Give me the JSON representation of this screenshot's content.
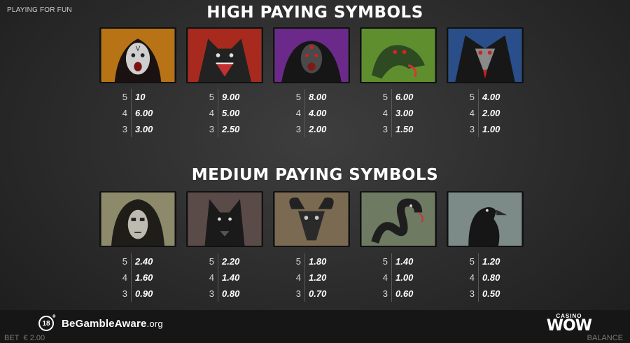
{
  "mode_label": "PLAYING FOR FUN",
  "high": {
    "title": "HIGH PAYING SYMBOLS",
    "symbols": [
      {
        "icon": "witch-face-icon",
        "bg": "#b87316",
        "pays": [
          {
            "count": "5",
            "amount": "10"
          },
          {
            "count": "4",
            "amount": "6.00"
          },
          {
            "count": "3",
            "amount": "3.00"
          }
        ]
      },
      {
        "icon": "werewolf-icon",
        "bg": "#a82a1e",
        "pays": [
          {
            "count": "5",
            "amount": "9.00"
          },
          {
            "count": "4",
            "amount": "5.00"
          },
          {
            "count": "3",
            "amount": "2.50"
          }
        ]
      },
      {
        "icon": "demon-icon",
        "bg": "#6b2a8a",
        "pays": [
          {
            "count": "5",
            "amount": "8.00"
          },
          {
            "count": "4",
            "amount": "4.00"
          },
          {
            "count": "3",
            "amount": "2.00"
          }
        ]
      },
      {
        "icon": "serpent-dragon-icon",
        "bg": "#5e8e2e",
        "pays": [
          {
            "count": "5",
            "amount": "6.00"
          },
          {
            "count": "4",
            "amount": "3.00"
          },
          {
            "count": "3",
            "amount": "1.50"
          }
        ]
      },
      {
        "icon": "raven-skull-icon",
        "bg": "#2a4e8a",
        "pays": [
          {
            "count": "5",
            "amount": "4.00"
          },
          {
            "count": "4",
            "amount": "2.00"
          },
          {
            "count": "3",
            "amount": "1.00"
          }
        ]
      }
    ]
  },
  "medium": {
    "title": "MEDIUM PAYING SYMBOLS",
    "symbols": [
      {
        "icon": "hooded-ghoul-icon",
        "bg": "#8c8a6a",
        "pays": [
          {
            "count": "5",
            "amount": "2.40"
          },
          {
            "count": "4",
            "amount": "1.60"
          },
          {
            "count": "3",
            "amount": "0.90"
          }
        ]
      },
      {
        "icon": "wolf-icon",
        "bg": "#5a4a48",
        "pays": [
          {
            "count": "5",
            "amount": "2.20"
          },
          {
            "count": "4",
            "amount": "1.40"
          },
          {
            "count": "3",
            "amount": "0.80"
          }
        ]
      },
      {
        "icon": "goat-skull-icon",
        "bg": "#7a6a52",
        "pays": [
          {
            "count": "5",
            "amount": "1.80"
          },
          {
            "count": "4",
            "amount": "1.20"
          },
          {
            "count": "3",
            "amount": "0.70"
          }
        ]
      },
      {
        "icon": "snake-icon",
        "bg": "#6e7a62",
        "pays": [
          {
            "count": "5",
            "amount": "1.40"
          },
          {
            "count": "4",
            "amount": "1.00"
          },
          {
            "count": "3",
            "amount": "0.60"
          }
        ]
      },
      {
        "icon": "crow-icon",
        "bg": "#7c8a88",
        "pays": [
          {
            "count": "5",
            "amount": "1.20"
          },
          {
            "count": "4",
            "amount": "0.80"
          },
          {
            "count": "3",
            "amount": "0.50"
          }
        ]
      }
    ]
  },
  "footer": {
    "age_label": "18",
    "age_plus": "+",
    "gamble_brand": "BeGambleAware",
    "gamble_domain": ".org",
    "casino_label": "CASINO",
    "casino_name": "WOW",
    "bet_label": "BET",
    "bet_value": "€ 2.00",
    "balance_label": "BALANCE"
  }
}
